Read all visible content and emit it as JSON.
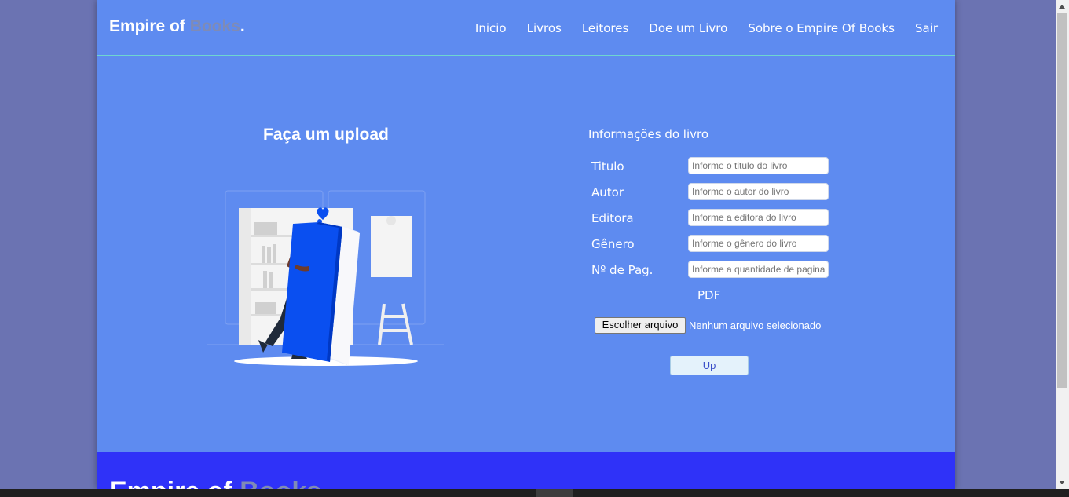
{
  "nav": {
    "brand_main": "Empire of ",
    "brand_accent": "Books",
    "brand_dot": ".",
    "links": [
      "Inicio",
      "Livros",
      "Leitores",
      "Doe um Livro",
      "Sobre o Empire Of Books",
      "Sair"
    ]
  },
  "upload": {
    "title": "Faça um upload"
  },
  "form": {
    "title": "Informações do livro",
    "fields": [
      {
        "label": "Titulo",
        "placeholder": "Informe o titulo do livro"
      },
      {
        "label": "Autor",
        "placeholder": "Informe o autor do livro"
      },
      {
        "label": "Editora",
        "placeholder": "Informe a editora do livro"
      },
      {
        "label": "Gênero",
        "placeholder": "Informe o gênero do livro"
      },
      {
        "label": "Nº de Pag.",
        "placeholder": "Informe a quantidade de paginas"
      }
    ],
    "pdf_label": "PDF",
    "file_button": "Escolher arquivo",
    "file_status": "Nenhum arquivo selecionado",
    "submit": "Up"
  },
  "footer": {
    "brand_main": "Empire of ",
    "brand_accent": "Books"
  },
  "colors": {
    "page_bg": "#5e8bf0",
    "outer_bg": "#6b73b2",
    "footer_bg": "#2f32f8",
    "brand_accent": "#7f8bb5",
    "book_blue": "#0a4ff0"
  }
}
